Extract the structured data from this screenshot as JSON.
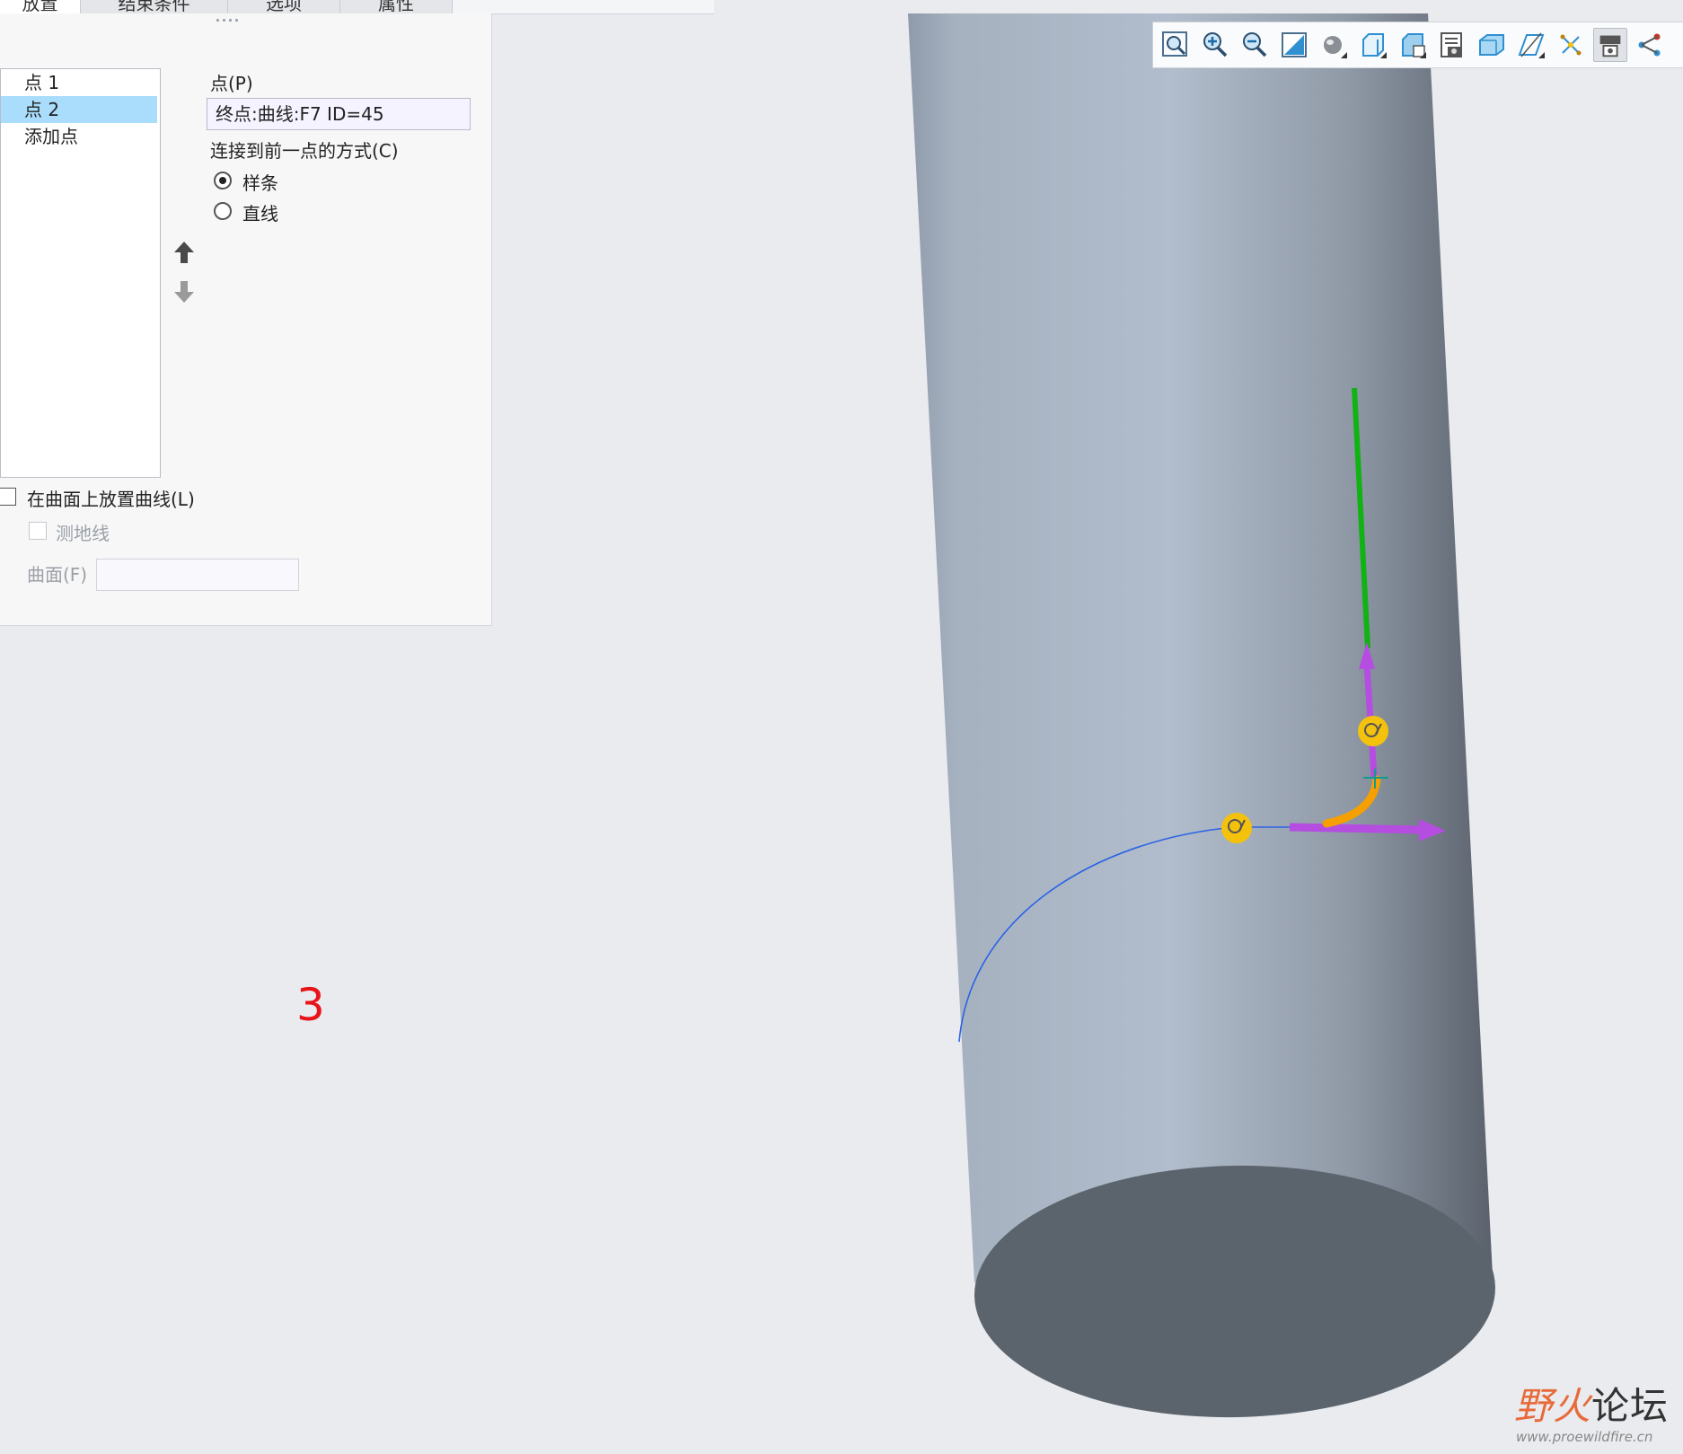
{
  "tabs": [
    {
      "label": "放置",
      "active": true
    },
    {
      "label": "结束条件",
      "active": false
    },
    {
      "label": "选项",
      "active": false
    },
    {
      "label": "属性",
      "active": false
    }
  ],
  "point_list": {
    "items": [
      {
        "label": "点 1",
        "selected": false
      },
      {
        "label": "点 2",
        "selected": true
      },
      {
        "label": "添加点",
        "selected": false
      }
    ]
  },
  "point_field": {
    "label": "点(P)",
    "value": "终点:曲线:F7 ID=45"
  },
  "connection": {
    "label": "连接到前一点的方式(C)",
    "options": [
      {
        "label": "样条",
        "checked": true
      },
      {
        "label": "直线",
        "checked": false
      }
    ]
  },
  "surface": {
    "place_on_surface_label": "在曲面上放置曲线(L)",
    "geodesic_label": "测地线",
    "surface_field_label": "曲面(F)",
    "surface_field_value": ""
  },
  "toolbar": {
    "buttons": [
      "refit-icon",
      "zoom-in-icon",
      "zoom-out-icon",
      "repaint-icon",
      "display-style-icon",
      "saved-orientations-icon",
      "view-manager-icon",
      "perspective-icon",
      "section-icon",
      "plane-display-icon",
      "datum-display-icon",
      "spin-center-icon",
      "annotation-display-icon"
    ]
  },
  "annotation": {
    "step_number": "3"
  },
  "watermark": {
    "logo_text_a": "野火",
    "logo_text_b": "论坛",
    "url": "www.proewildfire.cn"
  },
  "colors": {
    "selection": "#a9ddfb",
    "step_number": "#e8141c",
    "cylinder_light": "#adbaca",
    "cylinder_dark": "#5b636d",
    "spline_blue": "#2b63e6",
    "green_axis": "#10b313",
    "magenta_handle": "#b44de0",
    "orange_tangent": "#f5a000",
    "yellow_point": "#f4c20d"
  }
}
